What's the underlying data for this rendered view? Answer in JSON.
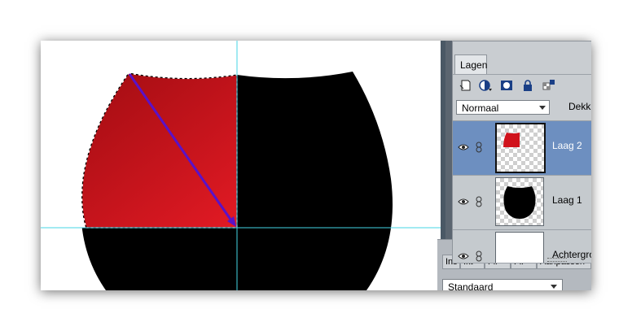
{
  "layers_panel": {
    "tab_label": "Lagen",
    "blend_mode": "Normaal",
    "opacity_label": "Dekk",
    "layers": [
      {
        "name": "Laag 2",
        "selected": true
      },
      {
        "name": "Laag 1",
        "selected": false
      },
      {
        "name": "Achtergrond",
        "selected": false
      }
    ]
  },
  "bottom_panel": {
    "tabs": [
      "Ins",
      "Ikt",
      "Fil",
      "Fil",
      "Aanpassen"
    ],
    "preset_value": "Standaard"
  },
  "colors": {
    "shape": "#000000",
    "gradient_dark": "#9a0b10",
    "gradient_light": "#e21a24",
    "guide": "#44d6e6",
    "arrow": "#5a12c8",
    "selected_layer": "#6d8fc0"
  }
}
